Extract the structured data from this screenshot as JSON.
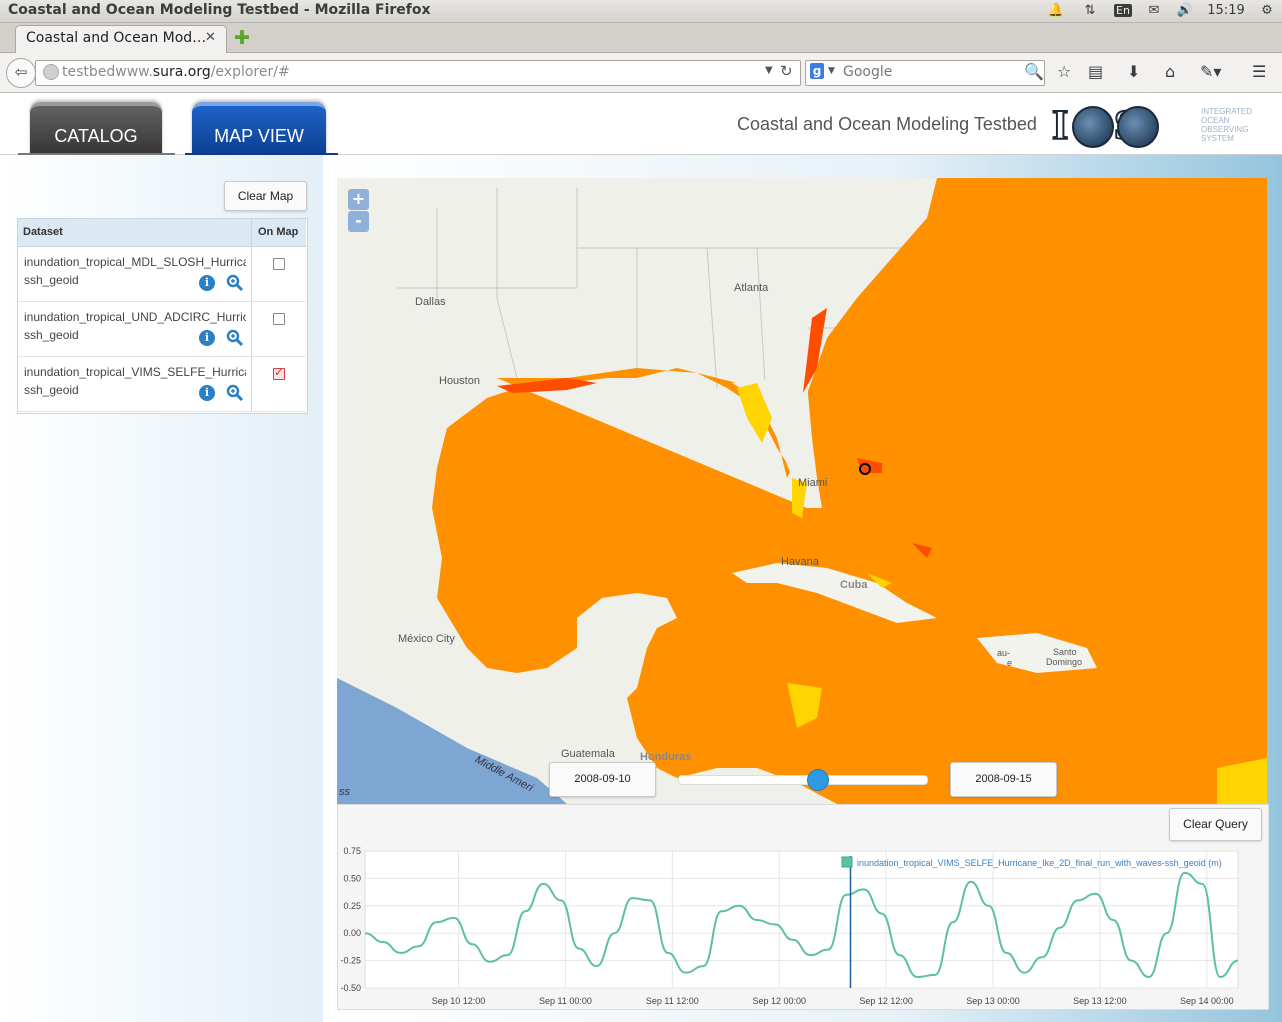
{
  "window": {
    "title": "Coastal and Ocean Modeling Testbed - Mozilla Firefox"
  },
  "tray": {
    "lang": "En",
    "time": "15:19"
  },
  "browser": {
    "tab_title": "Coastal and Ocean Mod…",
    "tab_close": "✕",
    "new_tab": "✚",
    "url_prefix": "testbedwww.",
    "url_domain": "sura.org",
    "url_suffix": "/explorer/#",
    "search_engine": "g",
    "search_placeholder": "Google"
  },
  "header": {
    "tabs": [
      {
        "label": "CATALOG"
      },
      {
        "label": "MAP VIEW"
      }
    ],
    "site_title": "Coastal and Ocean Modeling Testbed",
    "logo_text": "I O S",
    "logo_sub": [
      "INTEGRATED",
      "OCEAN",
      "OBSERVING",
      "SYSTEM"
    ]
  },
  "sidebar": {
    "clear_map_label": "Clear Map",
    "table": {
      "col_dataset": "Dataset",
      "col_onmap": "On Map",
      "rows": [
        {
          "name": "inundation_tropical_MDL_SLOSH_Hurricane_Ike",
          "variable": "ssh_geoid",
          "on_map": false
        },
        {
          "name": "inundation_tropical_UND_ADCIRC_Hurricane_Ike",
          "variable": "ssh_geoid",
          "on_map": false
        },
        {
          "name": "inundation_tropical_VIMS_SELFE_Hurricane_Ike",
          "variable": "ssh_geoid",
          "on_map": true
        }
      ]
    }
  },
  "map": {
    "zoom_in": "+",
    "zoom_out": "-",
    "labels": {
      "dallas": "Dallas",
      "atlanta": "Atlanta",
      "houston": "Houston",
      "miami": "Miami",
      "havana": "Havana",
      "cuba": "Cuba",
      "mexico_city": "México City",
      "guatemala": "Guatemala",
      "honduras": "Honduras",
      "santo": "Santo",
      "domingo": "Domingo",
      "port": "au-",
      "port2": "e",
      "middle_america": "Middle Ameri",
      "ss": "ss"
    },
    "start_date": "2008-09-10",
    "end_date": "2008-09-15",
    "slider_position": 0.56,
    "colors": {
      "ocean_model": "#ff9100",
      "high": "#ff5a00",
      "low": "#ffd000"
    }
  },
  "query": {
    "clear_label": "Clear Query"
  },
  "chart_data": {
    "type": "line",
    "legend": "inundation_tropical_VIMS_SELFE_Hurricane_Ike_2D_final_run_with_waves-ssh_geoid (m)",
    "ylim": [
      -0.5,
      0.75
    ],
    "yticks": [
      "0.75",
      "0.50",
      "0.25",
      "0.00",
      "-0.25",
      "-0.50"
    ],
    "xticks": [
      "Sep 10 12:00",
      "Sep 11 00:00",
      "Sep 11 12:00",
      "Sep 12 00:00",
      "Sep 12 12:00",
      "Sep 13 00:00",
      "Sep 13 12:00",
      "Sep 14 00:00",
      "Sep 14 12:00"
    ],
    "x_range_hours": [
      0,
      98
    ],
    "cursor_hour": 54.5,
    "line_color": "#5cc0a2",
    "series": [
      {
        "values_hours": [
          0,
          2,
          4,
          6,
          8,
          10,
          12,
          14,
          16,
          18,
          20,
          22,
          24,
          26,
          28,
          30,
          32,
          34,
          36,
          38,
          40,
          42,
          44,
          46,
          48,
          50,
          52,
          54,
          56,
          58,
          60,
          62,
          64,
          66,
          68,
          70,
          72,
          74,
          76,
          78,
          80,
          82,
          84,
          86,
          88,
          90,
          92,
          94,
          96,
          98
        ],
        "values": [
          0.0,
          -0.08,
          -0.18,
          -0.12,
          0.1,
          0.14,
          -0.1,
          -0.26,
          -0.2,
          0.2,
          0.45,
          0.3,
          -0.14,
          -0.3,
          0.0,
          0.32,
          0.3,
          -0.18,
          -0.36,
          -0.3,
          0.2,
          0.25,
          0.12,
          0.08,
          -0.06,
          -0.2,
          -0.15,
          0.35,
          0.4,
          0.18,
          -0.2,
          -0.4,
          -0.38,
          0.1,
          0.47,
          0.25,
          -0.18,
          -0.36,
          -0.22,
          0.05,
          0.3,
          0.36,
          0.12,
          -0.25,
          -0.4,
          0.0,
          0.55,
          0.45,
          -0.4,
          -0.25
        ]
      }
    ]
  }
}
